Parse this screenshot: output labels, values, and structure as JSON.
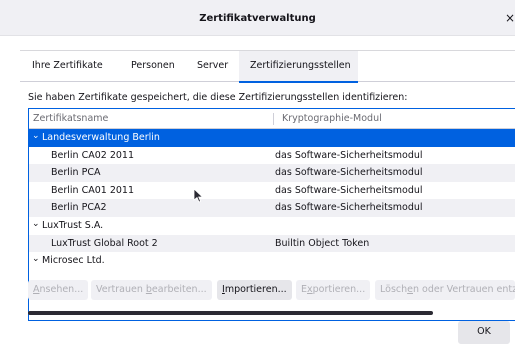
{
  "window": {
    "title": "Zertifikatverwaltung",
    "close_glyph": "×"
  },
  "tabs": [
    {
      "label": "Ihre Zertifikate"
    },
    {
      "label": "Personen"
    },
    {
      "label": "Server"
    },
    {
      "label": "Zertifizierungsstellen",
      "active": true
    }
  ],
  "description": "Sie haben Zertifikate gespeichert, die diese Zertifizierungsstellen identifizieren:",
  "table": {
    "columns": [
      "Zertifikatsname",
      "Kryptographie-Modul"
    ],
    "rows": [
      {
        "type": "group",
        "name": "Landesverwaltung Berlin",
        "selected": true
      },
      {
        "type": "cert",
        "name": "Berlin CA02 2011",
        "module": "das Software-Sicherheitsmodul"
      },
      {
        "type": "cert",
        "name": "Berlin PCA",
        "module": "das Software-Sicherheitsmodul"
      },
      {
        "type": "cert",
        "name": "Berlin CA01 2011",
        "module": "das Software-Sicherheitsmodul"
      },
      {
        "type": "cert",
        "name": "Berlin PCA2",
        "module": "das Software-Sicherheitsmodul"
      },
      {
        "type": "group",
        "name": "LuxTrust S.A."
      },
      {
        "type": "cert",
        "name": "LuxTrust Global Root 2",
        "module": "Builtin Object Token"
      },
      {
        "type": "group",
        "name": "Microsec Ltd."
      }
    ]
  },
  "buttons": {
    "view": {
      "pre": "",
      "key": "A",
      "post": "nsehen..."
    },
    "edit_trust": {
      "pre": "Vertrauen ",
      "key": "b",
      "post": "earbeiten..."
    },
    "import": {
      "pre": "",
      "key": "I",
      "post": "mportieren..."
    },
    "export": {
      "pre": "E",
      "key": "x",
      "post": "portieren..."
    },
    "delete": {
      "pre": "Lösch",
      "key": "e",
      "post": "n oder Vertrauen entziehen..."
    }
  },
  "ok_label": "OK",
  "icons": {
    "group_expanded": "chevron-down-icon",
    "cursor": "mouse-pointer-icon"
  },
  "colors": {
    "accent": "#0061e0",
    "disabled_text": "#b0b0b6"
  }
}
